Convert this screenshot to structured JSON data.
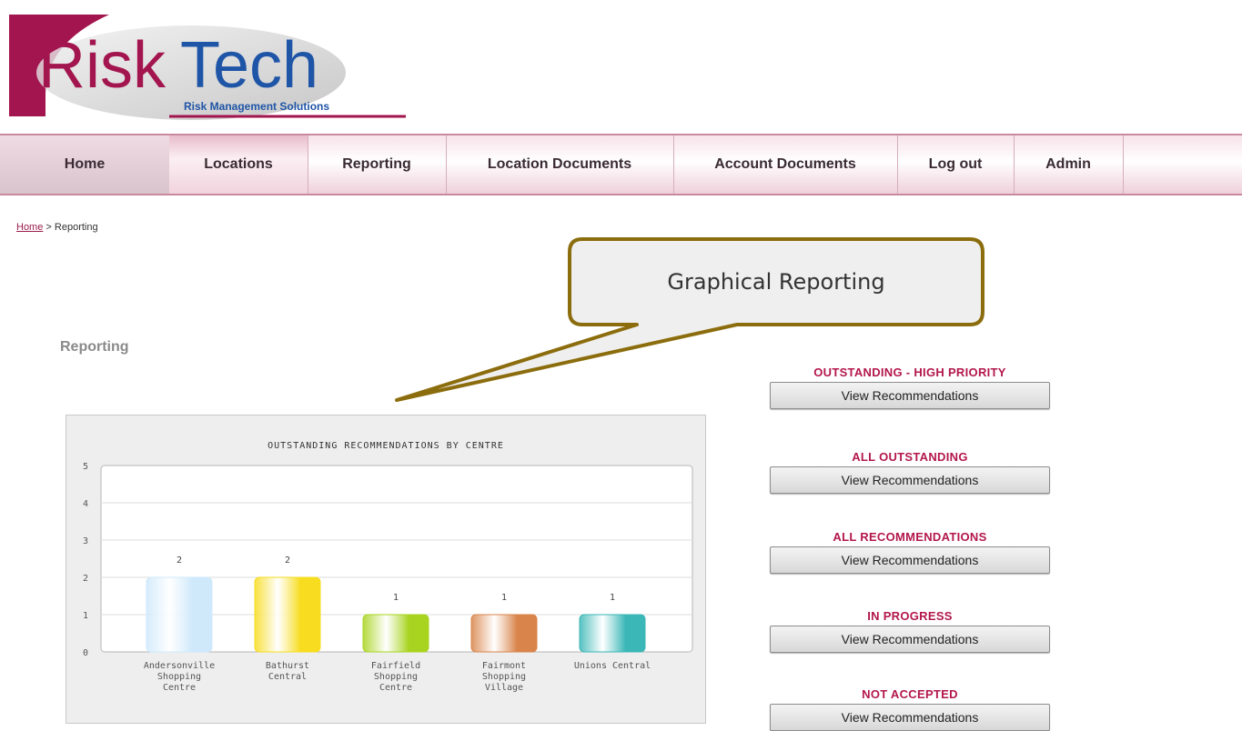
{
  "logo": {
    "name": "RiskTech",
    "tagline": "Risk Management Solutions"
  },
  "nav": {
    "items": [
      {
        "label": "Home"
      },
      {
        "label": "Locations"
      },
      {
        "label": "Reporting"
      },
      {
        "label": "Location Documents"
      },
      {
        "label": "Account Documents"
      },
      {
        "label": "Log out"
      },
      {
        "label": "Admin"
      }
    ]
  },
  "breadcrumb": {
    "home": "Home",
    "separator": " > ",
    "current": "Reporting"
  },
  "callout": {
    "text": "Graphical Reporting"
  },
  "page": {
    "title": "Reporting"
  },
  "chart_data": {
    "type": "bar",
    "title": "OUTSTANDING RECOMMENDATIONS BY CENTRE",
    "categories": [
      [
        "Andersonville",
        "Shopping",
        "Centre"
      ],
      [
        "Bathurst",
        "Central"
      ],
      [
        "Fairfield",
        "Shopping",
        "Centre"
      ],
      [
        "Fairmont",
        "Shopping",
        "Village"
      ],
      [
        "Unions Central"
      ]
    ],
    "values": [
      2,
      2,
      1,
      1,
      1
    ],
    "colors": [
      "#cfe9fb",
      "#f7dc1f",
      "#a8d41f",
      "#d9844a",
      "#3bb7b7"
    ],
    "ylim": [
      0,
      5
    ],
    "yticks": [
      0,
      1,
      2,
      3,
      4,
      5
    ],
    "grid": true
  },
  "recommendations": [
    {
      "label": "OUTSTANDING - HIGH PRIORITY",
      "button": "View Recommendations"
    },
    {
      "label": "ALL OUTSTANDING",
      "button": "View Recommendations"
    },
    {
      "label": "ALL RECOMMENDATIONS",
      "button": "View Recommendations"
    },
    {
      "label": "IN PROGRESS",
      "button": "View Recommendations"
    },
    {
      "label": "NOT ACCEPTED",
      "button": "View Recommendations"
    }
  ]
}
